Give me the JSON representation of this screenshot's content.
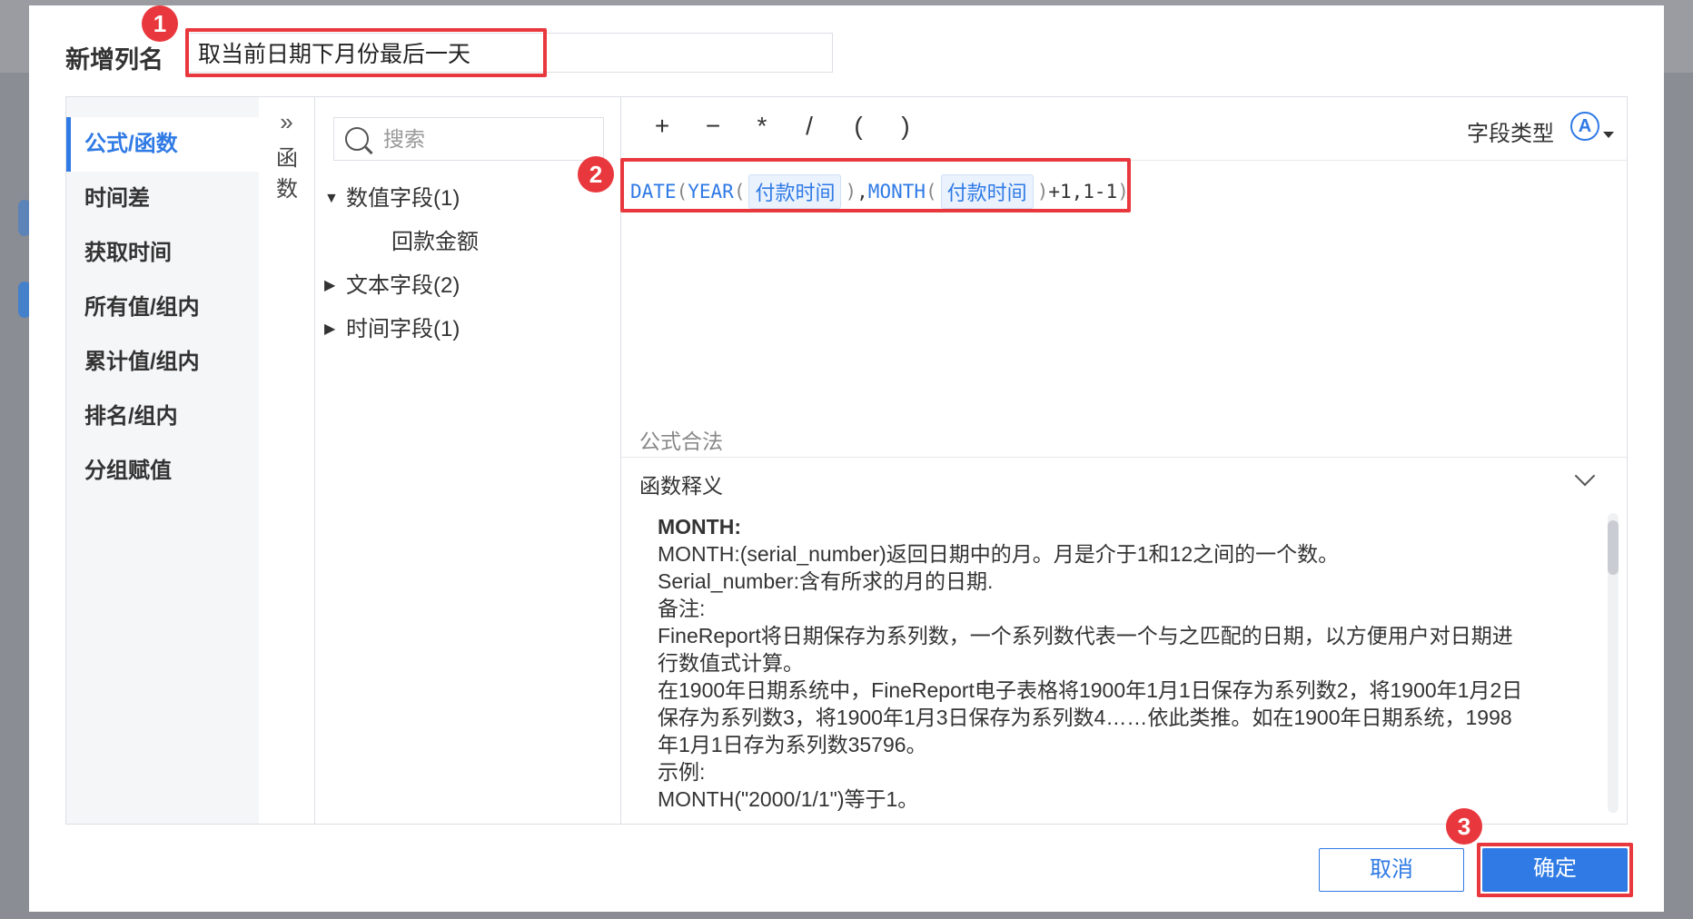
{
  "dialog": {
    "title": "新增列名",
    "column_name_value": "取当前日期下月份最后一天"
  },
  "annotations": {
    "badge1": "1",
    "badge2": "2",
    "badge3": "3"
  },
  "categories": [
    "公式/函数",
    "时间差",
    "获取时间",
    "所有值/组内",
    "累计值/组内",
    "排名/组内",
    "分组赋值"
  ],
  "collapse": {
    "arrow": "»",
    "text": "函数"
  },
  "search": {
    "placeholder": "搜索"
  },
  "fields": {
    "numeric": {
      "label": "数值字段(1)",
      "children": [
        "回款金额"
      ]
    },
    "text": {
      "label": "文本字段(2)"
    },
    "time": {
      "label": "时间字段(1)"
    }
  },
  "operators": [
    "+",
    "−",
    "*",
    "/",
    "(",
    ")"
  ],
  "field_type": {
    "label": "字段类型",
    "icon": "A"
  },
  "formula": {
    "fn_date": "DATE",
    "fn_year": "YEAR",
    "fn_month": "MONTH",
    "field1": "付款时间",
    "field2": "付款时间",
    "open": "(",
    "close": ")",
    "comma": ",",
    "tail": "+1,1-1"
  },
  "validation": "公式合法",
  "description": {
    "header": "函数释义",
    "title": "MONTH:",
    "lines": [
      "MONTH:(serial_number)返回日期中的月。月是介于1和12之间的一个数。",
      "Serial_number:含有所求的月的日期.",
      "备注:",
      "FineReport将日期保存为系列数，一个系列数代表一个与之匹配的日期，以方便用户对日期进",
      "行数值式计算。",
      "在1900年日期系统中，FineReport电子表格将1900年1月1日保存为系列数2，将1900年1月2日",
      "保存为系列数3，将1900年1月3日保存为系列数4……依此类推。如在1900年日期系统，1998",
      "年1月1日存为系列数35796。",
      "示例:",
      "MONTH(\"2000/1/1\")等于1。"
    ]
  },
  "buttons": {
    "cancel": "取消",
    "ok": "确定"
  },
  "colors": {
    "accent": "#2f7ae5",
    "highlight": "#e8383d"
  }
}
